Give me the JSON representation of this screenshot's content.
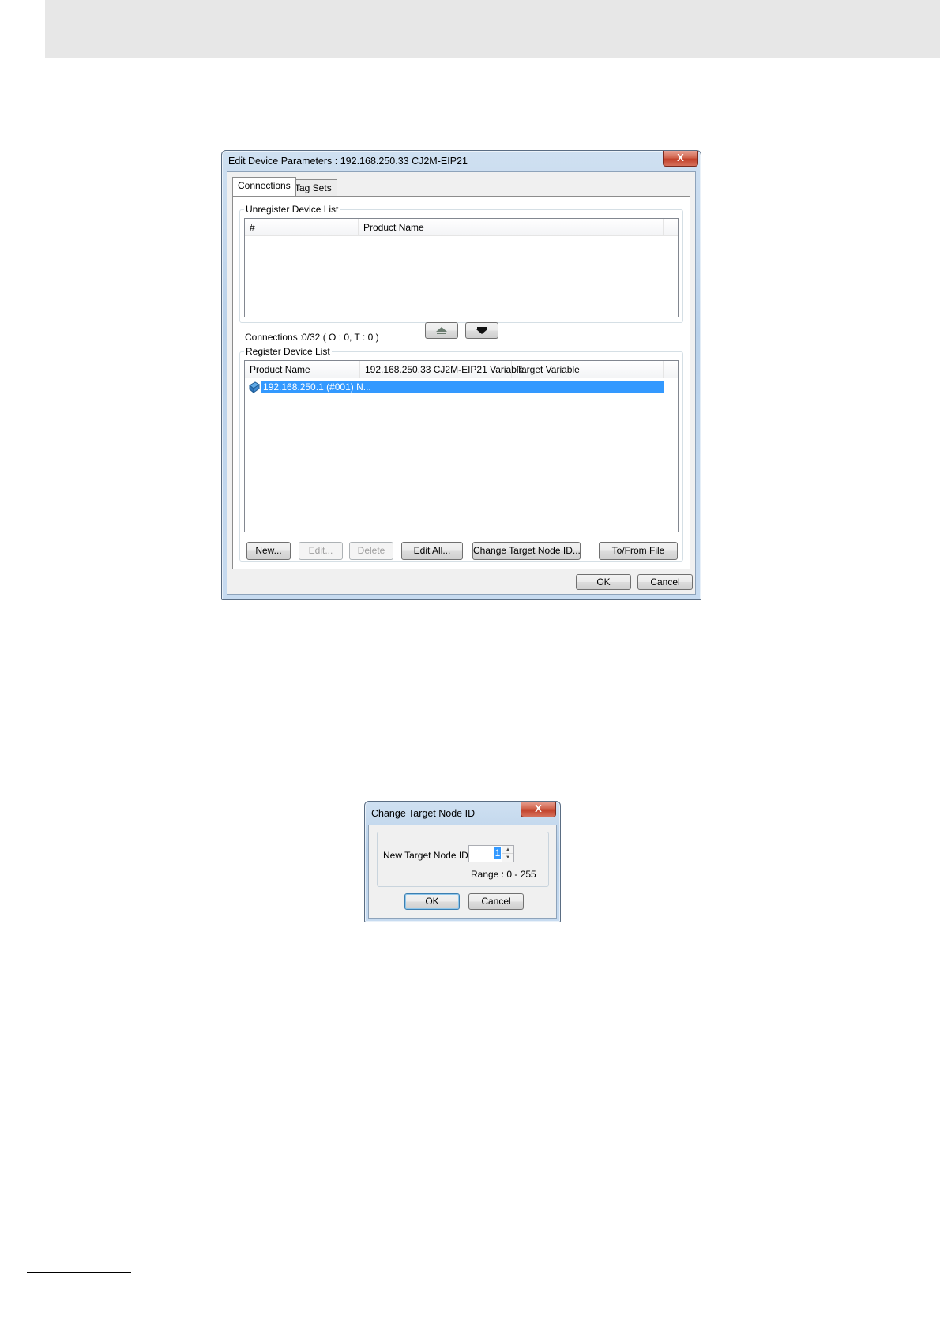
{
  "edit_dialog": {
    "title": "Edit Device Parameters : 192.168.250.33 CJ2M-EIP21",
    "close_label": "X",
    "tabs": [
      "Connections",
      "Tag Sets"
    ],
    "unregister": {
      "group_label": "Unregister Device List",
      "columns": [
        "#",
        "Product Name"
      ]
    },
    "connections_label": "Connections :",
    "connections_value": "0/32 ( O : 0, T : 0 )",
    "register": {
      "group_label": "Register Device List",
      "columns": [
        "Product Name",
        "192.168.250.33 CJ2M-EIP21 Variable",
        "Target Variable"
      ],
      "rows": [
        {
          "product_name": "192.168.250.1 (#001) N...",
          "selected": true
        }
      ]
    },
    "buttons": {
      "new": "New...",
      "edit": "Edit...",
      "delete": "Delete",
      "edit_all": "Edit All...",
      "change_target": "Change Target Node ID...",
      "to_from_file": "To/From File",
      "ok": "OK",
      "cancel": "Cancel"
    },
    "icons": {
      "move_up": "move-up-arrow-icon",
      "move_down": "move-down-arrow-icon",
      "device": "device-node-icon"
    }
  },
  "change_dialog": {
    "title": "Change Target Node ID",
    "close_label": "X",
    "field_label": "New Target Node ID :",
    "field_value": "1",
    "range_text": "Range : 0 - 255",
    "ok": "OK",
    "cancel": "Cancel"
  },
  "colors": {
    "selection": "#3399ff",
    "frame": "#b9d1ea",
    "close": "#c2412a"
  }
}
